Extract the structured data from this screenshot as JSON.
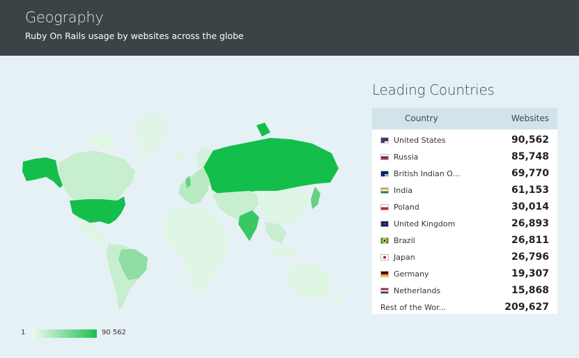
{
  "header": {
    "title": "Geography",
    "subtitle": "Ruby On Rails usage by websites across the globe"
  },
  "legend": {
    "min": "1",
    "max": "90 562"
  },
  "panel": {
    "title": "Leading Countries",
    "col_country": "Country",
    "col_websites": "Websites",
    "rows": [
      {
        "flag": "us-flag-icon",
        "name": "United States",
        "value": "90,562"
      },
      {
        "flag": "ru-flag-icon",
        "name": "Russia",
        "value": "85,748"
      },
      {
        "flag": "io-flag-icon",
        "name": "British Indian O...",
        "value": "69,770"
      },
      {
        "flag": "in-flag-icon",
        "name": "India",
        "value": "61,153"
      },
      {
        "flag": "pl-flag-icon",
        "name": "Poland",
        "value": "30,014"
      },
      {
        "flag": "gb-flag-icon",
        "name": "United Kingdom",
        "value": "26,893"
      },
      {
        "flag": "br-flag-icon",
        "name": "Brazil",
        "value": "26,811"
      },
      {
        "flag": "jp-flag-icon",
        "name": "Japan",
        "value": "26,796"
      },
      {
        "flag": "de-flag-icon",
        "name": "Germany",
        "value": "19,307"
      },
      {
        "flag": "nl-flag-icon",
        "name": "Netherlands",
        "value": "15,868"
      },
      {
        "flag": "",
        "name": "Rest of the Wor...",
        "value": "209,627"
      }
    ]
  },
  "colors": {
    "high": "#13bf4a",
    "mid": "#a8e6b8",
    "low": "#dff6e4",
    "header_bg": "#3c4347",
    "page_bg": "#e6f1f6"
  }
}
